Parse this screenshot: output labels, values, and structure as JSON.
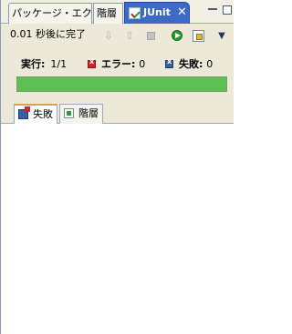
{
  "tabs": [
    {
      "label": "パッケージ・エクス...",
      "active": false
    },
    {
      "label": "階層",
      "active": false
    },
    {
      "label": "JUnit",
      "active": true,
      "close": "✕"
    }
  ],
  "toolbar": {
    "status": "0.01 秒後に完了",
    "icons": [
      "next-failure-icon",
      "previous-failure-icon",
      "stop-icon",
      "rerun-icon",
      "scroll-lock-icon",
      "view-menu-icon"
    ]
  },
  "counters": {
    "run_label": "実行:",
    "run_value": "1/1",
    "error_label": "エラー:",
    "error_value": "0",
    "failure_label": "失敗:",
    "failure_value": "0"
  },
  "progress": {
    "fraction": 1.0,
    "color": "#5ebf55"
  },
  "lower_tabs": [
    {
      "label": "失敗",
      "active": true
    },
    {
      "label": "階層",
      "active": false
    }
  ],
  "colors": {
    "accent": "#3d6ac5",
    "success": "#5ebf55",
    "error": "#cc2626"
  }
}
